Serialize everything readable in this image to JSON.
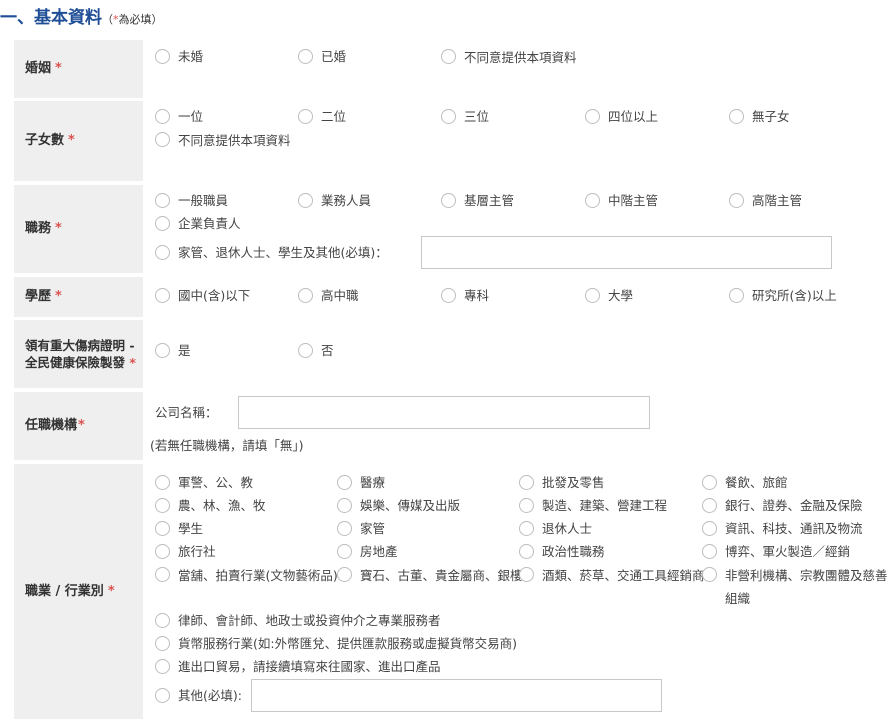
{
  "section": {
    "title": "一、基本資料",
    "note_open": "（",
    "note_star": "*",
    "note_text": "為必填）"
  },
  "rows": {
    "marital": {
      "label": "婚姻",
      "req": "*",
      "options": [
        "未婚",
        "已婚",
        "不同意提供本項資料"
      ]
    },
    "children": {
      "label": "子女數",
      "req": "*",
      "options": [
        "一位",
        "二位",
        "三位",
        "四位以上",
        "無子女",
        "不同意提供本項資料"
      ]
    },
    "position": {
      "label": "職務",
      "req": "*",
      "options": [
        "一般職員",
        "業務人員",
        "基層主管",
        "中階主管",
        "高階主管",
        "企業負責人",
        "家管、退休人士、學生及其他(必填)："
      ]
    },
    "education": {
      "label": "學歷",
      "req": "*",
      "options": [
        "國中(含)以下",
        "高中職",
        "專科",
        "大學",
        "研究所(含)以上"
      ]
    },
    "illness": {
      "label": "領有重大傷病證明 - 全民健康保險製發",
      "req": "*",
      "options": [
        "是",
        "否"
      ]
    },
    "employer": {
      "label": "任職機構",
      "req": "*",
      "company_label": "公司名稱：",
      "hint": "(若無任職機構，請填「無」)"
    },
    "industry": {
      "label": "職業 / 行業別",
      "req": "*",
      "options": [
        "軍警、公、教",
        "醫療",
        "批發及零售",
        "餐飲、旅館",
        "農、林、漁、牧",
        "娛樂、傳媒及出版",
        "製造、建築、營建工程",
        "銀行、證券、金融及保險",
        "學生",
        "家管",
        "退休人士",
        "資訊、科技、通訊及物流",
        "旅行社",
        "房地產",
        "政治性職務",
        "博弈、軍火製造／經銷",
        "當舖、拍賣行業(文物藝術品)",
        "寶石、古董、貴金屬商、銀樓",
        "酒類、菸草、交通工具經銷商",
        "非營利機構、宗教團體及慈善組織",
        "律師、會計師、地政士或投資仲介之專業服務者",
        "貨幣服務行業(如:外幣匯兌、提供匯款服務或虛擬貨幣交易商)",
        "進出口貿易，請接續填寫來往國家、進出口產品",
        "其他(必填):"
      ]
    }
  },
  "colors": {
    "title": "#1f4e96",
    "required": "#d9534f",
    "label_bg": "#efefef"
  }
}
